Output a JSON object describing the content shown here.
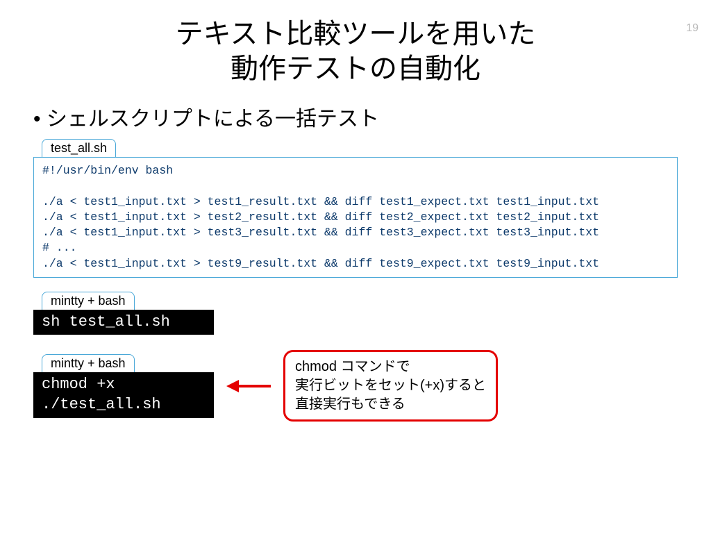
{
  "page_number": "19",
  "title_line1": "テキスト比較ツールを用いた",
  "title_line2": "動作テストの自動化",
  "bullet1": "シェルスクリプトによる一括テスト",
  "tab1": "test_all.sh",
  "code1": "#!/usr/bin/env bash\n\n./a < test1_input.txt > test1_result.txt && diff test1_expect.txt test1_input.txt\n./a < test1_input.txt > test2_result.txt && diff test2_expect.txt test2_input.txt\n./a < test1_input.txt > test3_result.txt && diff test3_expect.txt test3_input.txt\n# ...\n./a < test1_input.txt > test9_result.txt && diff test9_expect.txt test9_input.txt",
  "tab2": "mintty + bash",
  "code2": "sh test_all.sh",
  "tab3": "mintty + bash",
  "code3": "chmod +x\n./test_all.sh",
  "callout_line1": "chmod コマンドで",
  "callout_line2": "実行ビットをセット(+x)すると",
  "callout_line3": "直接実行もできる"
}
